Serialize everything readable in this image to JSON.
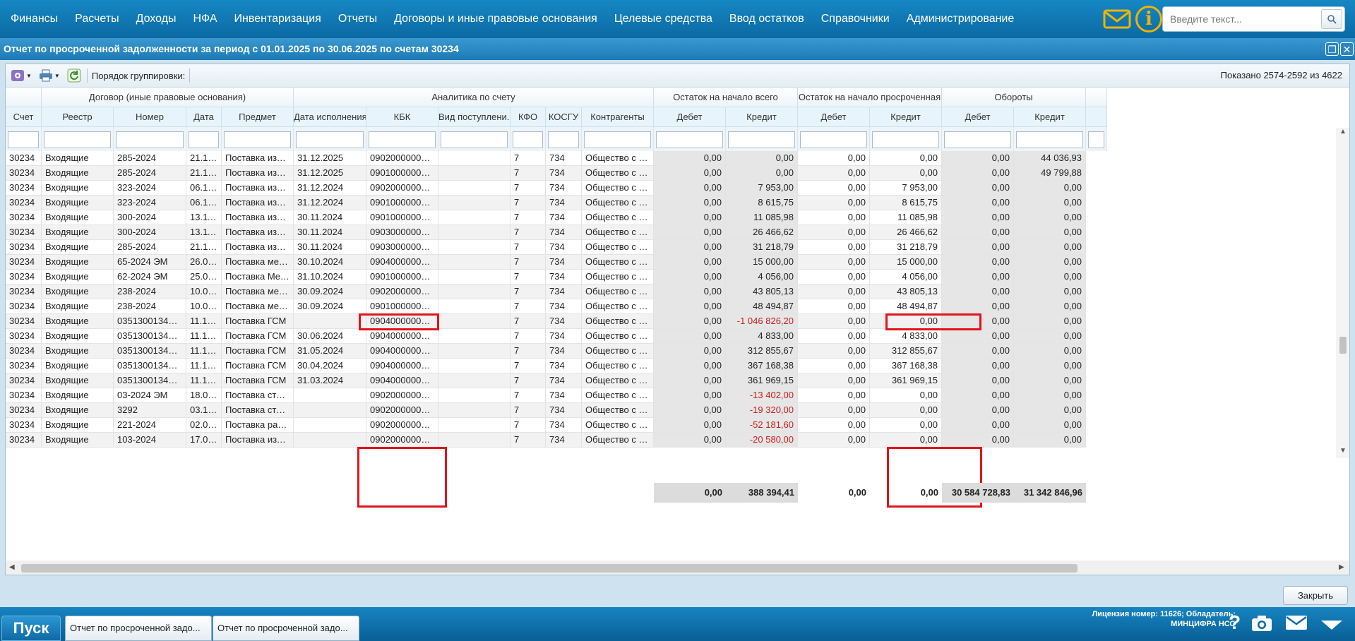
{
  "menu": [
    "Финансы",
    "Расчеты",
    "Доходы",
    "НФА",
    "Инвентаризация",
    "Отчеты",
    "Договоры и иные правовые основания",
    "Целевые средства",
    "Ввод остатков",
    "Справочники",
    "Администрирование"
  ],
  "search": {
    "placeholder": "Введите текст..."
  },
  "window": {
    "title": "Отчет по просроченной задолженности за период с 01.01.2025 по 30.06.2025 по счетам 30234"
  },
  "toolbar": {
    "grouping_label": "Порядок группировки:",
    "shown": "Показано 2574-2592 из 4622"
  },
  "grid": {
    "groups": [
      "Договор (иные правовые основания)",
      "Аналитика по счету",
      "Остаток на начало всего",
      "Остаток на начало просроченная",
      "Обороты"
    ],
    "columns": [
      "Счет",
      "Реестр",
      "Номер",
      "Дата",
      "Предмет",
      "Дата исполнения",
      "КБК",
      "Вид поступлени...",
      "КФО",
      "КОСГУ",
      "Контрагенты",
      "Дебет",
      "Кредит",
      "Дебет",
      "Кредит",
      "Дебет",
      "Кредит"
    ],
    "rows": [
      [
        "30234",
        "Входящие",
        "285-2024",
        "21.10....",
        "Поставка издел...",
        "31.12.2025",
        "0902000000000...",
        "",
        "7",
        "734",
        "Общество с огр...",
        "0,00",
        "0,00",
        "0,00",
        "0,00",
        "0,00",
        "44 036,93"
      ],
      [
        "30234",
        "Входящие",
        "285-2024",
        "21.10....",
        "Поставка издел...",
        "31.12.2025",
        "0901000000000...",
        "",
        "7",
        "734",
        "Общество с огр...",
        "0,00",
        "0,00",
        "0,00",
        "0,00",
        "0,00",
        "49 799,88"
      ],
      [
        "30234",
        "Входящие",
        "323-2024",
        "06.12....",
        "Поставка издел...",
        "31.12.2024",
        "0902000000000...",
        "",
        "7",
        "734",
        "Общество с огр...",
        "0,00",
        "7 953,00",
        "0,00",
        "7 953,00",
        "0,00",
        "0,00"
      ],
      [
        "30234",
        "Входящие",
        "323-2024",
        "06.12....",
        "Поставка издел...",
        "31.12.2024",
        "0901000000000...",
        "",
        "7",
        "734",
        "Общество с огр...",
        "0,00",
        "8 615,75",
        "0,00",
        "8 615,75",
        "0,00",
        "0,00"
      ],
      [
        "30234",
        "Входящие",
        "300-2024",
        "13.11....",
        "Поставка издел...",
        "30.11.2024",
        "0901000000000...",
        "",
        "7",
        "734",
        "Общество с огр...",
        "0,00",
        "11 085,98",
        "0,00",
        "11 085,98",
        "0,00",
        "0,00"
      ],
      [
        "30234",
        "Входящие",
        "300-2024",
        "13.11....",
        "Поставка издел...",
        "30.11.2024",
        "0903000000000...",
        "",
        "7",
        "734",
        "Общество с огр...",
        "0,00",
        "26 466,62",
        "0,00",
        "26 466,62",
        "0,00",
        "0,00"
      ],
      [
        "30234",
        "Входящие",
        "285-2024",
        "21.10....",
        "Поставка издел...",
        "30.11.2024",
        "0903000000000...",
        "",
        "7",
        "734",
        "Общество с огр...",
        "0,00",
        "31 218,79",
        "0,00",
        "31 218,79",
        "0,00",
        "0,00"
      ],
      [
        "30234",
        "Входящие",
        "65-2024 ЭМ",
        "26.09....",
        "Поставка меди...",
        "30.10.2024",
        "0904000000000...",
        "",
        "7",
        "734",
        "Общество с огр...",
        "0,00",
        "15 000,00",
        "0,00",
        "15 000,00",
        "0,00",
        "0,00"
      ],
      [
        "30234",
        "Входящие",
        "62-2024 ЭМ",
        "25.09....",
        "Поставка Меди...",
        "31.10.2024",
        "0901000000000...",
        "",
        "7",
        "734",
        "Общество с огр...",
        "0,00",
        "4 056,00",
        "0,00",
        "4 056,00",
        "0,00",
        "0,00"
      ],
      [
        "30234",
        "Входящие",
        "238-2024",
        "10.09....",
        "Поставка меди...",
        "30.09.2024",
        "0902000000000...",
        "",
        "7",
        "734",
        "Общество с огр...",
        "0,00",
        "43 805,13",
        "0,00",
        "43 805,13",
        "0,00",
        "0,00"
      ],
      [
        "30234",
        "Входящие",
        "238-2024",
        "10.09....",
        "Поставка меди...",
        "30.09.2024",
        "0901000000000...",
        "",
        "7",
        "734",
        "Общество с огр...",
        "0,00",
        "48 494,87",
        "0,00",
        "48 494,87",
        "0,00",
        "0,00"
      ],
      [
        "30234",
        "Входящие",
        "0351300134723...",
        "11.10....",
        "Поставка ГСМ",
        "",
        "0904000000000...",
        "",
        "7",
        "734",
        "Общество с огр...",
        "0,00",
        "-1 046 826,20",
        "0,00",
        "0,00",
        "0,00",
        "0,00"
      ],
      [
        "30234",
        "Входящие",
        "0351300134723...",
        "11.10....",
        "Поставка ГСМ",
        "30.06.2024",
        "0904000000000...",
        "",
        "7",
        "734",
        "Общество с огр...",
        "0,00",
        "4 833,00",
        "0,00",
        "4 833,00",
        "0,00",
        "0,00"
      ],
      [
        "30234",
        "Входящие",
        "0351300134723...",
        "11.10....",
        "Поставка ГСМ",
        "31.05.2024",
        "0904000000000...",
        "",
        "7",
        "734",
        "Общество с огр...",
        "0,00",
        "312 855,67",
        "0,00",
        "312 855,67",
        "0,00",
        "0,00"
      ],
      [
        "30234",
        "Входящие",
        "0351300134723...",
        "11.10....",
        "Поставка ГСМ",
        "30.04.2024",
        "0904000000000...",
        "",
        "7",
        "734",
        "Общество с огр...",
        "0,00",
        "367 168,38",
        "0,00",
        "367 168,38",
        "0,00",
        "0,00"
      ],
      [
        "30234",
        "Входящие",
        "0351300134723...",
        "11.10....",
        "Поставка ГСМ",
        "31.03.2024",
        "0904000000000...",
        "",
        "7",
        "734",
        "Общество с огр...",
        "0,00",
        "361 969,15",
        "0,00",
        "361 969,15",
        "0,00",
        "0,00"
      ],
      [
        "30234",
        "Входящие",
        "03-2024 ЭМ",
        "18.01....",
        "Поставка стома...",
        "",
        "0902000000000...",
        "",
        "7",
        "734",
        "Общество с огр...",
        "0,00",
        "-13 402,00",
        "0,00",
        "0,00",
        "0,00",
        "0,00"
      ],
      [
        "30234",
        "Входящие",
        "3292",
        "03.10....",
        "Поставка стома...",
        "",
        "0902000000000...",
        "",
        "7",
        "734",
        "Общество с огр...",
        "0,00",
        "-19 320,00",
        "0,00",
        "0,00",
        "0,00",
        "0,00"
      ],
      [
        "30234",
        "Входящие",
        "221-2024",
        "02.09....",
        "Поставка расхо...",
        "",
        "0902000000000...",
        "",
        "7",
        "734",
        "Общество с огр...",
        "0,00",
        "-52 181,60",
        "0,00",
        "0,00",
        "0,00",
        "0,00"
      ],
      [
        "30234",
        "Входящие",
        "103-2024",
        "17.04....",
        "Поставка издел...",
        "",
        "0902000000000...",
        "",
        "7",
        "734",
        "Общество с огр...",
        "0,00",
        "-20 580,00",
        "0,00",
        "0,00",
        "0,00",
        "0,00"
      ]
    ],
    "totals": [
      "0,00",
      "388 394,41",
      "0,00",
      "0,00",
      "30 584 728,83",
      "31 342 846,96"
    ]
  },
  "buttons": {
    "close": "Закрыть"
  },
  "taskbar": {
    "start": "Пуск",
    "tabs": [
      "Отчет по просроченной задо...",
      "Отчет по просроченной задо..."
    ],
    "license_line1": "Лицензия номер: 11626; Обладатель:",
    "license_line2": "МИНЦИФРА НСО"
  },
  "colors": {
    "accent": "#0b6aa3",
    "negative": "#c8201e",
    "highlight": "#e0141b"
  }
}
